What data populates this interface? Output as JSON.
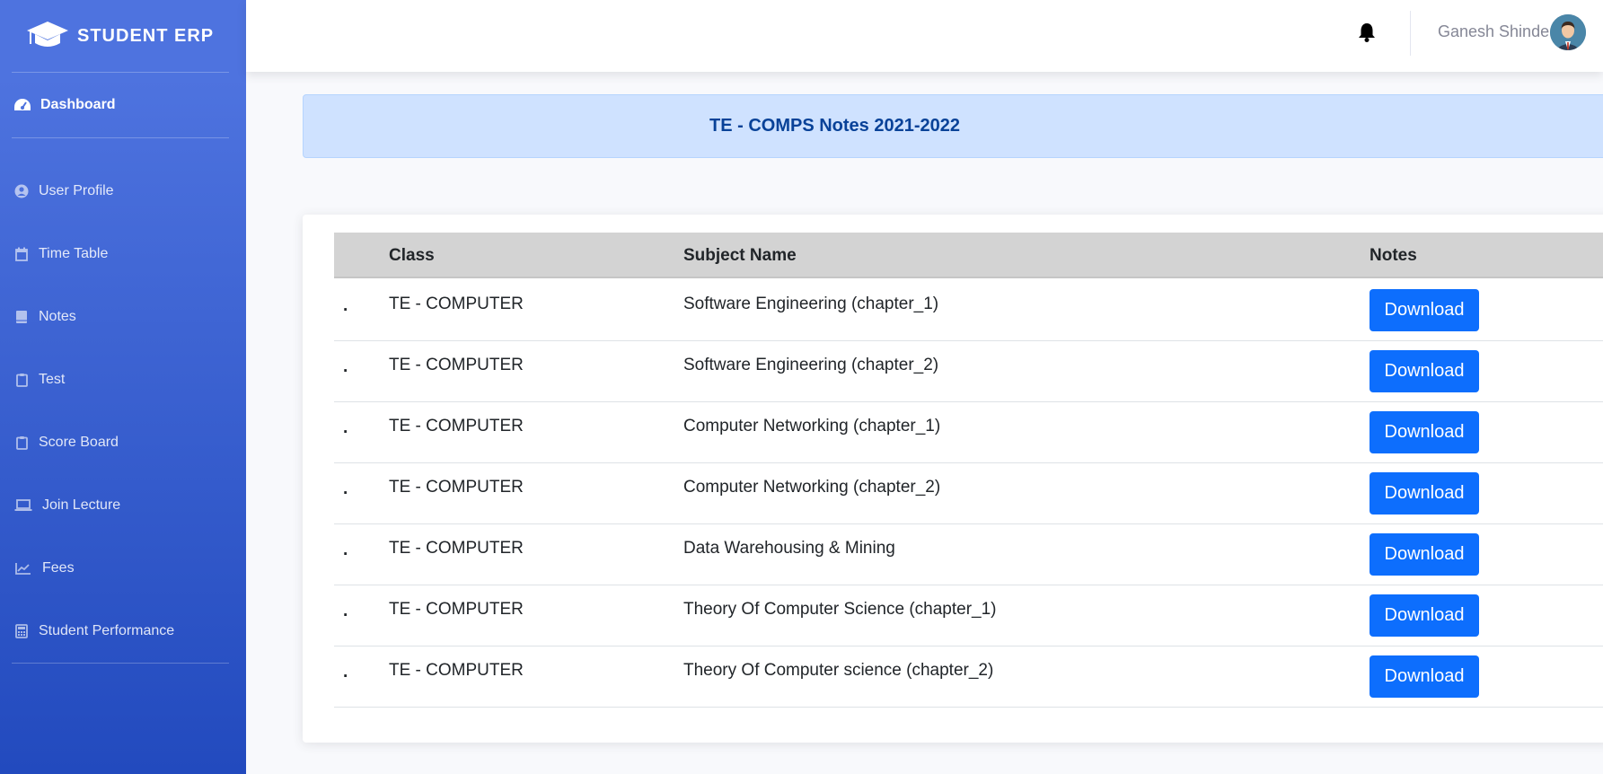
{
  "brand": {
    "title": "STUDENT ERP"
  },
  "sidebar": {
    "active": "Dashboard",
    "items": [
      {
        "label": "User Profile",
        "icon": "user-circle-icon"
      },
      {
        "label": "Time Table",
        "icon": "calendar-icon"
      },
      {
        "label": "Notes",
        "icon": "book-icon"
      },
      {
        "label": "Test",
        "icon": "clipboard-icon"
      },
      {
        "label": "Score Board",
        "icon": "clipboard-icon"
      },
      {
        "label": "Join Lecture",
        "icon": "laptop-icon"
      },
      {
        "label": "Fees",
        "icon": "chart-line-icon"
      },
      {
        "label": "Student Performance",
        "icon": "calculator-icon"
      }
    ]
  },
  "topbar": {
    "user_name": "Ganesh Shinde"
  },
  "banner": {
    "title": "TE - COMPS Notes 2021-2022"
  },
  "table": {
    "headers": {
      "class": "Class",
      "subject": "Subject Name",
      "notes": "Notes"
    },
    "rows": [
      {
        "index": ".",
        "class": "TE - COMPUTER",
        "subject": "Software Engineering (chapter_1)",
        "action": "Download"
      },
      {
        "index": ".",
        "class": "TE - COMPUTER",
        "subject": "Software Engineering (chapter_2)",
        "action": "Download"
      },
      {
        "index": ".",
        "class": "TE - COMPUTER",
        "subject": "Computer Networking (chapter_1)",
        "action": "Download"
      },
      {
        "index": ".",
        "class": "TE - COMPUTER",
        "subject": "Computer Networking (chapter_2)",
        "action": "Download"
      },
      {
        "index": ".",
        "class": "TE - COMPUTER",
        "subject": "Data Warehousing & Mining",
        "action": "Download"
      },
      {
        "index": ".",
        "class": "TE - COMPUTER",
        "subject": "Theory Of Computer Science (chapter_1)",
        "action": "Download"
      },
      {
        "index": ".",
        "class": "TE - COMPUTER",
        "subject": "Theory Of Computer science (chapter_2)",
        "action": "Download"
      }
    ]
  },
  "colors": {
    "sidebar_top": "#4e73df",
    "sidebar_bottom": "#224abe",
    "button": "#0d6efd",
    "banner_bg": "#cfe2ff",
    "banner_text": "#084298"
  }
}
